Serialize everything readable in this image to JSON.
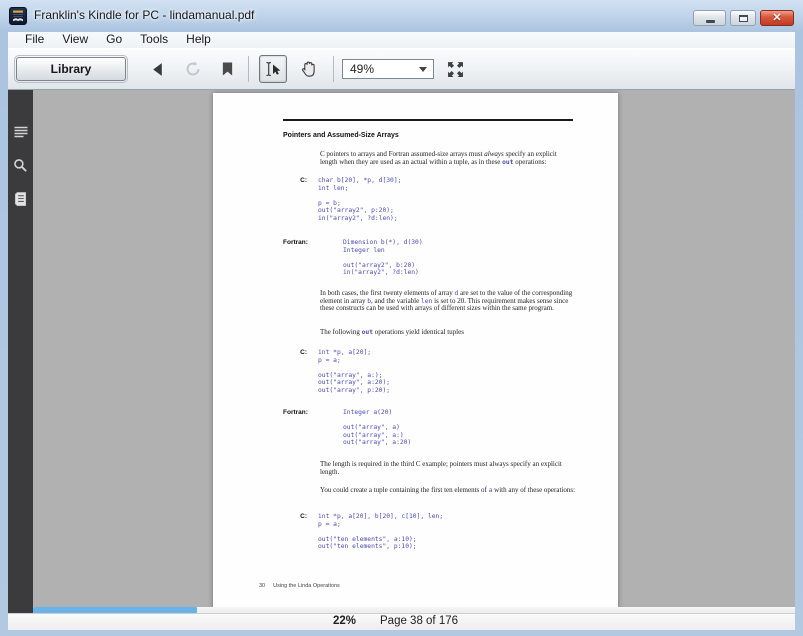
{
  "window": {
    "title": "Franklin's Kindle for PC - lindamanual.pdf"
  },
  "menu": {
    "items": [
      "File",
      "View",
      "Go",
      "Tools",
      "Help"
    ]
  },
  "toolbar": {
    "library_label": "Library",
    "zoom_value": "49%"
  },
  "icons": {
    "app": "kindle-logo",
    "back": "left-triangle",
    "sync": "refresh-arrows (disabled)",
    "bookmark": "bookmark-ribbon",
    "select_tool": "ibeam-with-cursor (active)",
    "hand_tool": "open-hand",
    "fit_screen": "expand-arrows",
    "rail_toc": "list-lines",
    "rail_search": "magnifier",
    "rail_notes": "note-page"
  },
  "colors": {
    "titlebar": "#bdd2e9",
    "sidebar_rail": "#3b3b3d",
    "document_bg": "#b1b1b1",
    "code_text": "#4a4ab2",
    "scroll_thumb": "#68b3e8",
    "close_button": "#c03a23"
  },
  "doc": {
    "heading": "Pointers and Assumed-Size Arrays",
    "para1": [
      "C pointers to arrays and Fortran assumed-size arrays must ",
      "always",
      " specify an explicit length when they are used as an actual within a tuple, as in these ",
      "out",
      " operations:"
    ],
    "code1": {
      "label": "C:",
      "lines": [
        "char b[20], *p, d[30];",
        "int len;",
        "",
        "p = b;",
        "out(\"array2\", p:20);",
        "in(\"array2\", ?d:len);"
      ]
    },
    "code2": {
      "label": "Fortran:",
      "lines": [
        "Dimension b(*), d(30)",
        "Integer len",
        "",
        "out(\"array2\", b:20)",
        "in(\"array2\", ?d:len)"
      ]
    },
    "para2": [
      "In both cases, the first twenty elements of array ",
      "d",
      " are set to the value of the corresponding element in array ",
      "b",
      ", and the variable ",
      "len",
      " is set to 20. This requirement makes sense since these constructs can be used with arrays of different sizes within the same program."
    ],
    "para3": [
      "The following ",
      "out",
      " operations yield identical tuples"
    ],
    "code3": {
      "label": "C:",
      "lines": [
        "int *p, a[20];",
        "p = a;",
        "",
        "out(\"array\", a:);",
        "out(\"array\", a:20);",
        "out(\"array\", p:20);"
      ]
    },
    "code4": {
      "label": "Fortran:",
      "lines": [
        "Integer a(20)",
        "",
        "out(\"array\", a)",
        "out(\"array\", a:)",
        "out(\"array\", a:20)"
      ]
    },
    "para4": "The length is required in the third C example; pointers must always specify an explicit length.",
    "para5": [
      "You could create a tuple containing the first ten elements of ",
      "a",
      " with any of these operations:"
    ],
    "code5": {
      "label": "C:",
      "lines": [
        "int *p, a[20], b[20], c[10], len;",
        "p = a;",
        "",
        "out(\"ten elements\", a:10);",
        "out(\"ten elements\", p:10);"
      ]
    },
    "footer": {
      "page_number": "30",
      "text": "Using the Linda Operations"
    }
  },
  "statusbar": {
    "progress": "22%",
    "page_info": "Page 38 of 176"
  }
}
